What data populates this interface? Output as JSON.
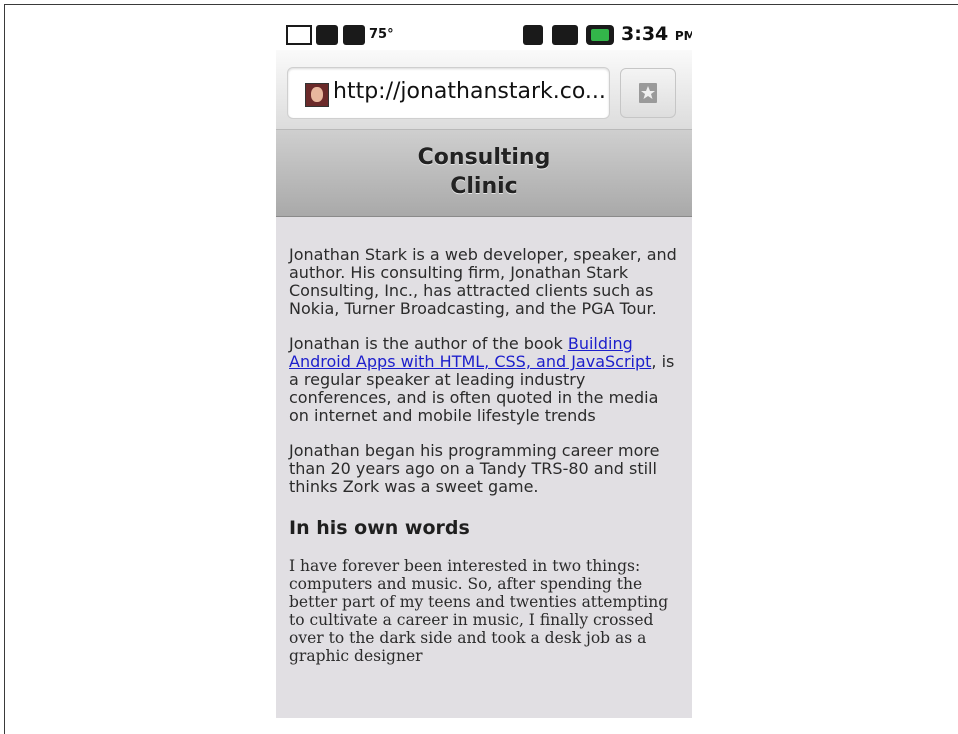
{
  "status_bar": {
    "icons": [
      "gmail-icon",
      "android-icon",
      "usb-icon",
      "wifi-icon",
      "signal-icon",
      "battery-icon"
    ],
    "temperature": "75°",
    "time": "3:34",
    "ampm": "PM",
    "battery_color": "#33b64a"
  },
  "browser": {
    "url": "http://jonathanstark.co...",
    "bookmark_icon": "star-icon"
  },
  "page": {
    "title_line1": "Consulting",
    "title_line2": "Clinic",
    "para1": "Jonathan Stark is a web developer, speaker, and author. His consulting firm, Jonathan Stark Consulting, Inc., has attracted clients such as Nokia, Turner Broadcasting, and the PGA Tour.",
    "para2_before": "Jonathan is the author of the book ",
    "para2_link": "Building Android Apps with HTML, CSS, and JavaScript",
    "para2_after": ", is a regular speaker at leading industry conferences, and is often quoted in the media on internet and mobile lifestyle trends",
    "para3": "Jonathan began his programming career more than 20 years ago on a Tandy TRS-80 and still thinks Zork was a sweet game.",
    "section_heading": "In his own words",
    "quote": "I have forever been interested in two things: computers and music. So, after spending the better part of my teens and twenties attempting to cultivate a career in music, I finally crossed over to the dark side and took a desk job as a graphic designer"
  }
}
